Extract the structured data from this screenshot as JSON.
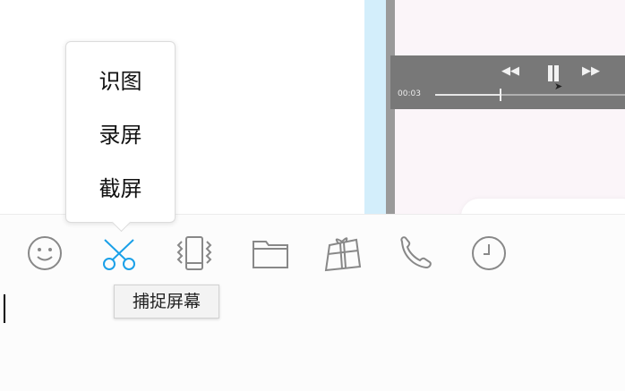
{
  "video": {
    "time": "00:03",
    "progress": 0.34,
    "controls": {
      "rewind_icon": "rewind-icon",
      "pause_icon": "pause-icon",
      "forward_icon": "fast-forward-icon"
    }
  },
  "capture_menu": {
    "items": [
      {
        "label": "识图"
      },
      {
        "label": "录屏"
      },
      {
        "label": "截屏"
      }
    ]
  },
  "toolbar": {
    "icons": [
      "emoji-icon",
      "scissors-icon",
      "phone-shake-icon",
      "folder-icon",
      "gift-box-icon",
      "phone-icon",
      "clock-icon"
    ],
    "active_color": "#1aa0e8",
    "icon_color": "#888888",
    "tooltip": "捕捉屏幕"
  }
}
